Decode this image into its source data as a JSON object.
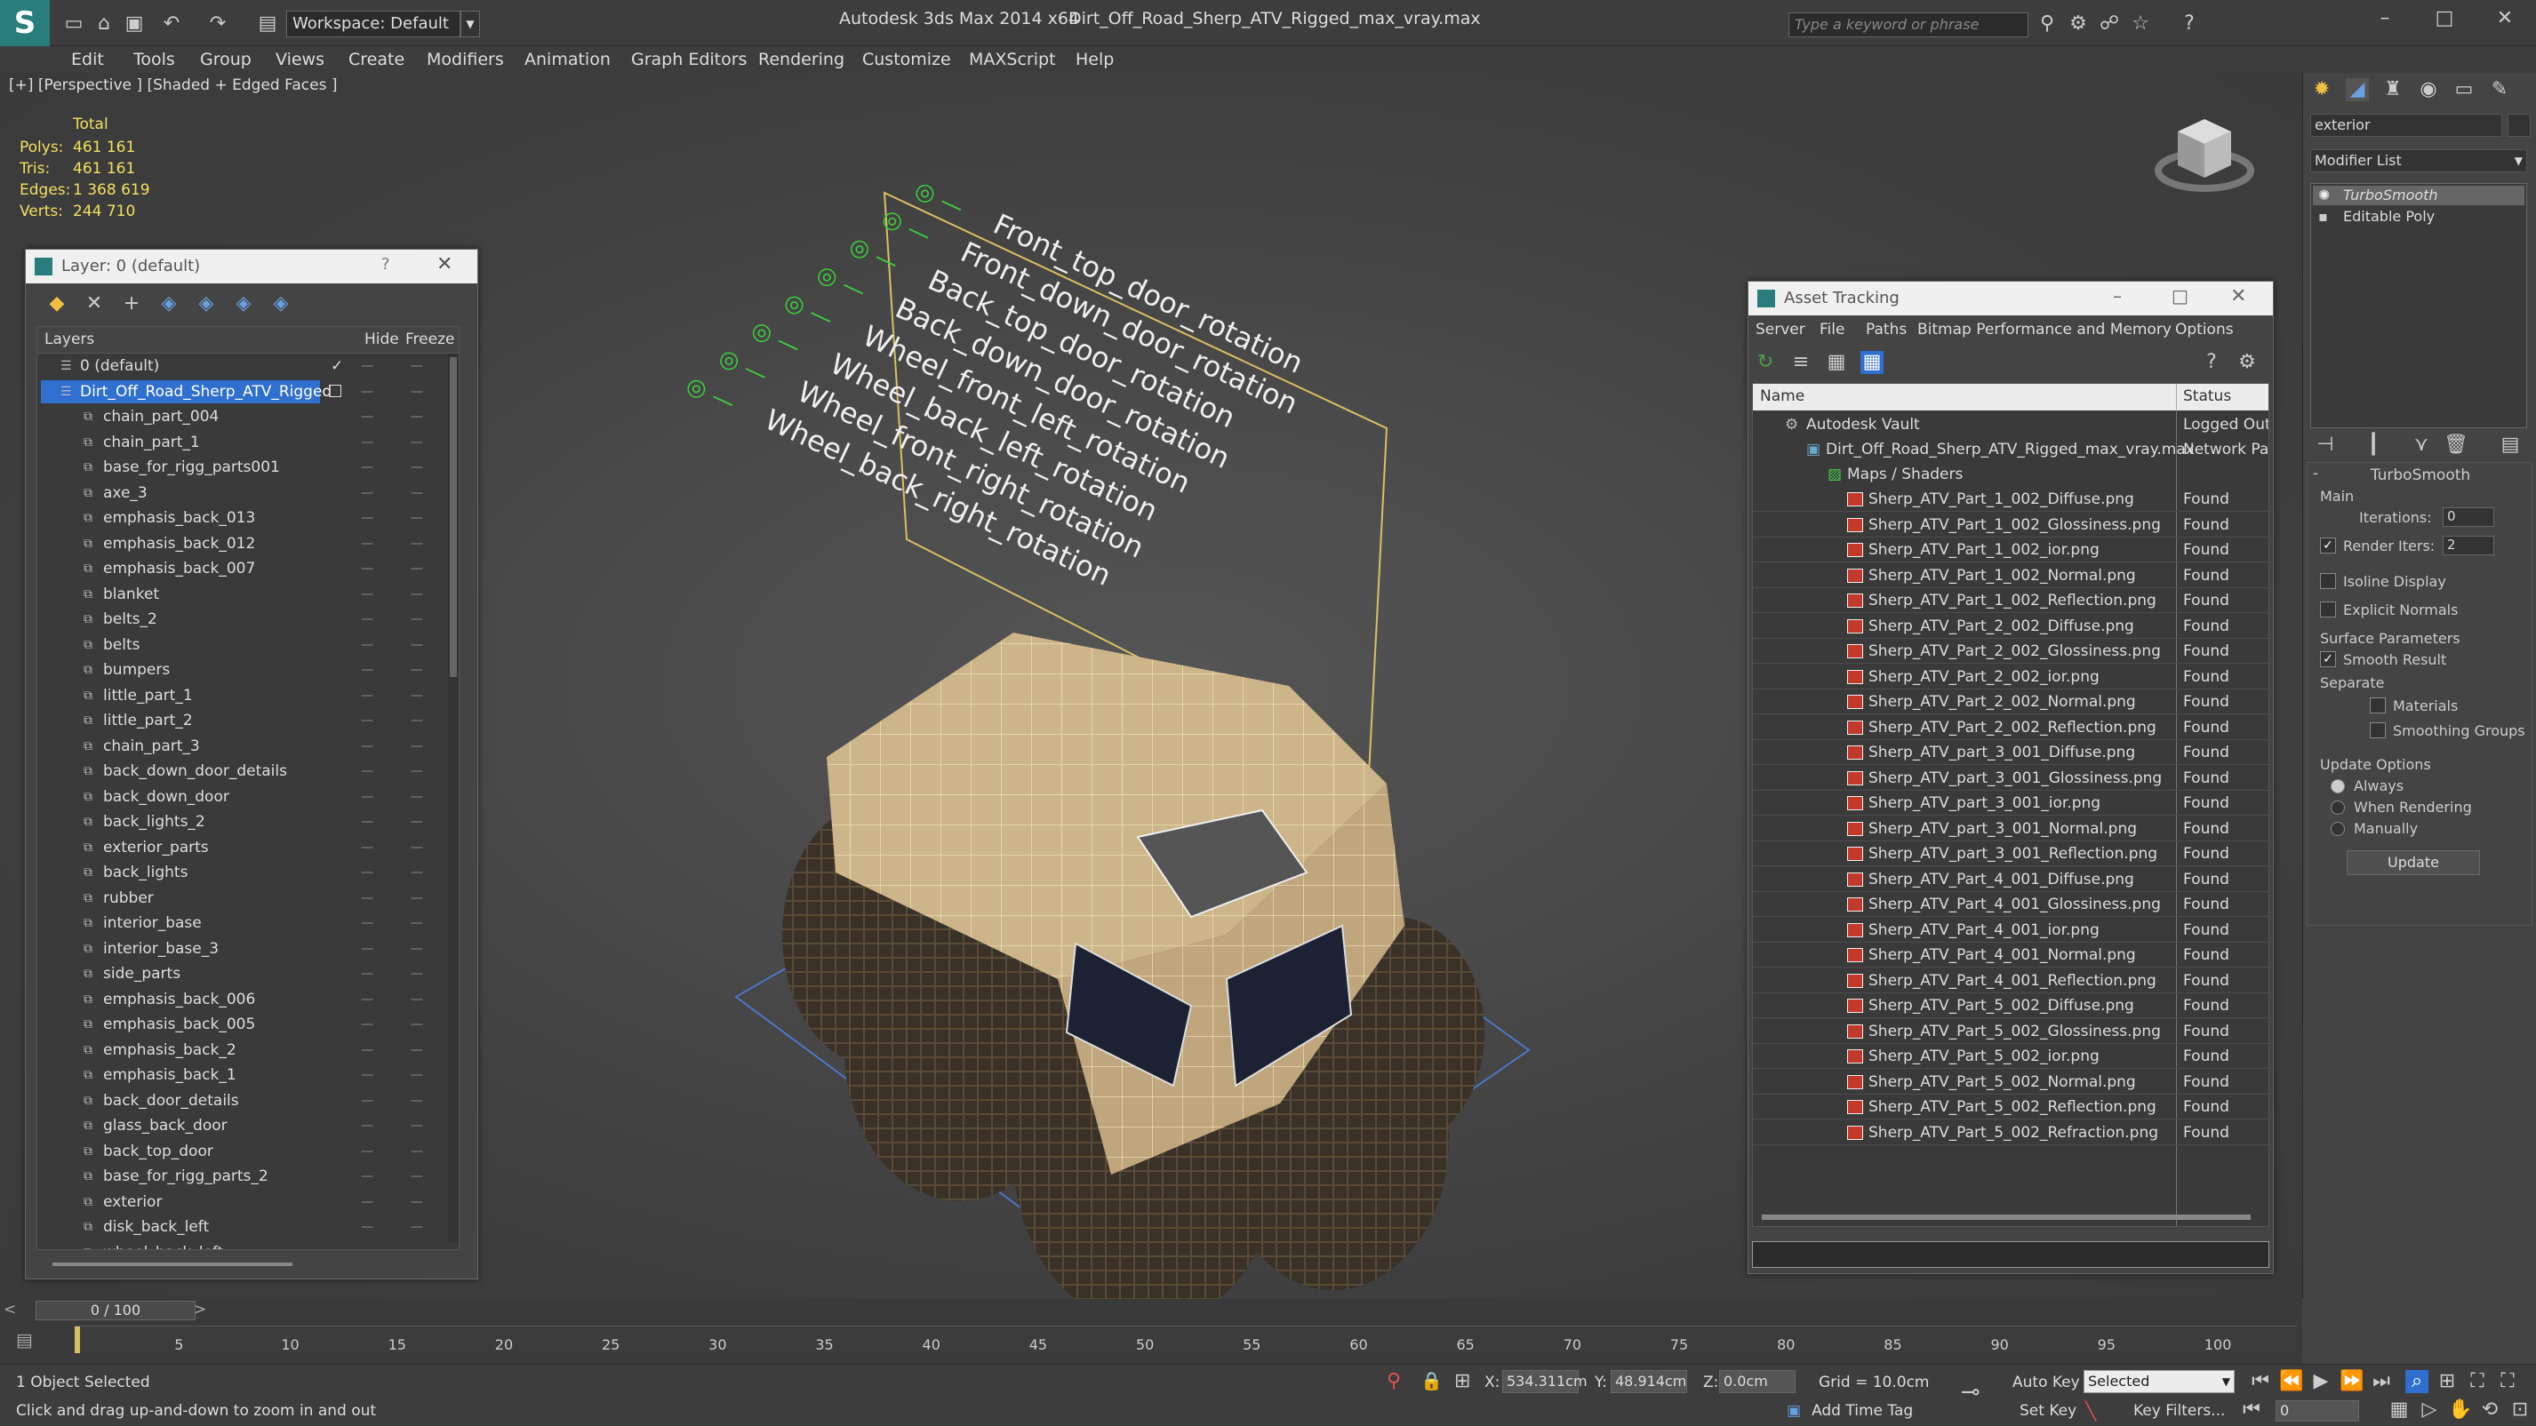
{
  "app": {
    "title": "Autodesk 3ds Max  2014 x64",
    "file": "Dirt_Off_Road_Sherp_ATV_Rigged_max_vray.max",
    "workspace": "Workspace: Default",
    "search_placeholder": "Type a keyword or phrase"
  },
  "menu": [
    "Edit",
    "Tools",
    "Group",
    "Views",
    "Create",
    "Modifiers",
    "Animation",
    "Graph Editors",
    "Rendering",
    "Customize",
    "MAXScript",
    "Help"
  ],
  "viewport": {
    "label": "[+] [Perspective ] [Shaded + Edged Faces ]",
    "stats": {
      "header": "Total",
      "rows": [
        {
          "k": "Polys:",
          "v": "461 161"
        },
        {
          "k": "Tris:",
          "v": "461 161"
        },
        {
          "k": "Edges:",
          "v": "1 368 619"
        },
        {
          "k": "Verts:",
          "v": "244 710"
        }
      ]
    },
    "rig_labels": [
      "Front_top_door_rotation",
      "Front_down_door_rotation",
      "Back_top_door_rotation",
      "Back_down_door_rotation",
      "Wheel_front_left_rotation",
      "Wheel_back_left_rotation",
      "Wheel_front_right_rotation",
      "Wheel_back_right_rotation"
    ]
  },
  "layer": {
    "title": "Layer: 0 (default)",
    "help": "?",
    "cols": {
      "layers": "Layers",
      "hide": "Hide",
      "freeze": "Freeze"
    },
    "items": [
      "0 (default)",
      "Dirt_Off_Road_Sherp_ATV_Rigged",
      "chain_part_004",
      "chain_part_1",
      "base_for_rigg_parts001",
      "axe_3",
      "emphasis_back_013",
      "emphasis_back_012",
      "emphasis_back_007",
      "blanket",
      "belts_2",
      "belts",
      "bumpers",
      "little_part_1",
      "little_part_2",
      "chain_part_3",
      "back_down_door_details",
      "back_down_door",
      "back_lights_2",
      "exterior_parts",
      "back_lights",
      "rubber",
      "interior_base",
      "interior_base_3",
      "side_parts",
      "emphasis_back_006",
      "emphasis_back_005",
      "emphasis_back_2",
      "emphasis_back_1",
      "back_door_details",
      "glass_back_door",
      "back_top_door",
      "base_for_rigg_parts_2",
      "exterior",
      "disk_back_left",
      "wheel_back_left"
    ]
  },
  "asset": {
    "title": "Asset Tracking",
    "menu": [
      "Server",
      "File",
      "Paths",
      "Bitmap Performance and Memory",
      "Options"
    ],
    "cols": {
      "name": "Name",
      "status": "Status"
    },
    "vault": {
      "name": "Autodesk Vault",
      "status": "Logged Out"
    },
    "file": {
      "name": "Dirt_Off_Road_Sherp_ATV_Rigged_max_vray.max",
      "status": "Network Pat"
    },
    "group": "Maps / Shaders",
    "found": "Found",
    "maps": [
      "Sherp_ATV_Part_1_002_Diffuse.png",
      "Sherp_ATV_Part_1_002_Glossiness.png",
      "Sherp_ATV_Part_1_002_ior.png",
      "Sherp_ATV_Part_1_002_Normal.png",
      "Sherp_ATV_Part_1_002_Reflection.png",
      "Sherp_ATV_Part_2_002_Diffuse.png",
      "Sherp_ATV_Part_2_002_Glossiness.png",
      "Sherp_ATV_Part_2_002_ior.png",
      "Sherp_ATV_Part_2_002_Normal.png",
      "Sherp_ATV_Part_2_002_Reflection.png",
      "Sherp_ATV_part_3_001_Diffuse.png",
      "Sherp_ATV_part_3_001_Glossiness.png",
      "Sherp_ATV_part_3_001_ior.png",
      "Sherp_ATV_part_3_001_Normal.png",
      "Sherp_ATV_part_3_001_Reflection.png",
      "Sherp_ATV_Part_4_001_Diffuse.png",
      "Sherp_ATV_Part_4_001_Glossiness.png",
      "Sherp_ATV_Part_4_001_ior.png",
      "Sherp_ATV_Part_4_001_Normal.png",
      "Sherp_ATV_Part_4_001_Reflection.png",
      "Sherp_ATV_Part_5_002_Diffuse.png",
      "Sherp_ATV_Part_5_002_Glossiness.png",
      "Sherp_ATV_Part_5_002_ior.png",
      "Sherp_ATV_Part_5_002_Normal.png",
      "Sherp_ATV_Part_5_002_Reflection.png",
      "Sherp_ATV_Part_5_002_Refraction.png"
    ]
  },
  "command": {
    "object_name": "exterior",
    "modifier_list": "Modifier List",
    "stack": [
      "TurboSmooth",
      "Editable Poly"
    ],
    "rollout": "TurboSmooth",
    "main": "Main",
    "iterations_label": "Iterations:",
    "iterations": "0",
    "render_iters_label": "Render Iters:",
    "render_iters": "2",
    "isoline": "Isoline Display",
    "explicit": "Explicit Normals",
    "surface": "Surface Parameters",
    "smooth": "Smooth Result",
    "separate": "Separate",
    "materials": "Materials",
    "smoothing_groups": "Smoothing Groups",
    "update_options": "Update Options",
    "always": "Always",
    "when_rendering": "When Rendering",
    "manually": "Manually",
    "update": "Update"
  },
  "timeline": {
    "frame": "0 / 100",
    "ticks": [
      "5",
      "10",
      "15",
      "20",
      "25",
      "30",
      "35",
      "40",
      "45",
      "50",
      "55",
      "60",
      "65",
      "70",
      "75",
      "80",
      "85",
      "90",
      "95",
      "100"
    ]
  },
  "status": {
    "selected": "1 Object Selected",
    "hint": "Click and drag up-and-down to zoom in and out",
    "x_label": "X:",
    "x": "534.311cm",
    "y_label": "Y:",
    "y": "48.914cm",
    "z_label": "Z:",
    "z": "0.0cm",
    "grid": "Grid = 10.0cm",
    "auto_key": "Auto Key",
    "set_key": "Set Key",
    "selected_dd": "Selected",
    "key_filters": "Key Filters...",
    "add_time_tag": "Add Time Tag",
    "frame_field": "0"
  },
  "colors": {
    "accent": "#2f6fd0",
    "found_icon": "#c0392b",
    "wireframe": "#f5e6a0"
  }
}
